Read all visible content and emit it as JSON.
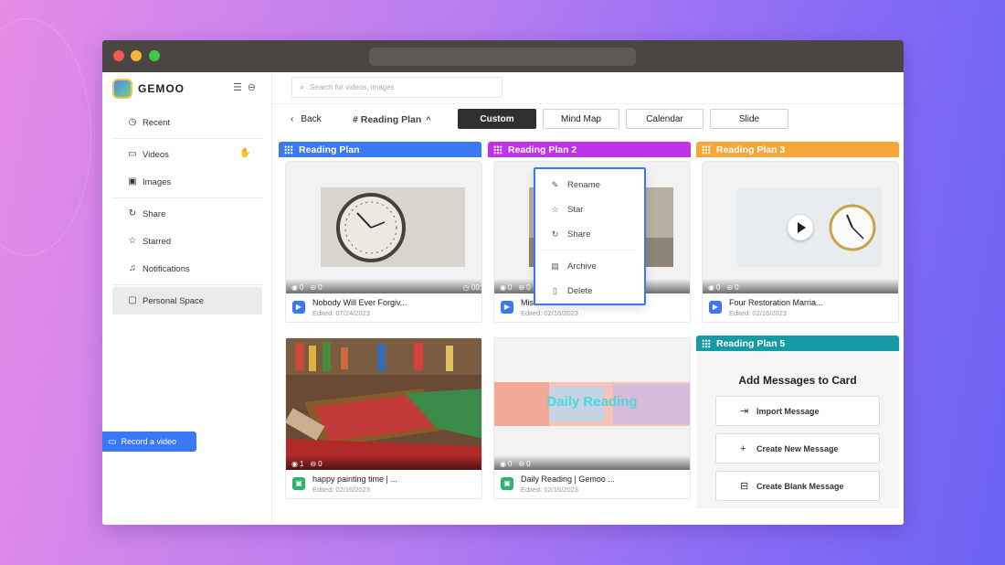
{
  "brand": {
    "name": "GEMOO"
  },
  "sidebar": {
    "items": [
      {
        "label": "Recent",
        "icon": "clock-icon"
      },
      {
        "label": "Videos",
        "icon": "video-icon"
      },
      {
        "label": "Images",
        "icon": "image-icon"
      },
      {
        "label": "Share",
        "icon": "share-icon"
      },
      {
        "label": "Starred",
        "icon": "star-icon"
      },
      {
        "label": "Notifications",
        "icon": "bell-icon"
      }
    ],
    "space": {
      "label": "Personal Space",
      "icon": "folder-icon"
    },
    "record_label": "Record a video"
  },
  "search": {
    "placeholder": "Search for videos, images"
  },
  "toolbar": {
    "back_label": "Back",
    "plan_title": "# Reading Plan",
    "views": [
      "Custom",
      "Mind Map",
      "Calendar",
      "Slide"
    ],
    "active_view": "Custom"
  },
  "menu": {
    "items": [
      "Rename",
      "Star",
      "Share",
      "Archive",
      "Delete"
    ]
  },
  "columns": [
    {
      "title": "Reading Plan",
      "color": "#3a78f5"
    },
    {
      "title": "Reading Plan 2",
      "color": "#c032e8"
    },
    {
      "title": "Reading Plan 3",
      "color": "#f7a63a"
    },
    {
      "title": "Reading Plan 5",
      "color": "#159aa6"
    }
  ],
  "cards": [
    {
      "title": "Nobody Will Ever Forgiv...",
      "date": "Edited: 07/24/2023",
      "views": "0",
      "comments": "0",
      "duration": "00:",
      "type": "video"
    },
    {
      "title": "happy painting time | ...",
      "date": "Edited: 02/16/2023",
      "views": "1",
      "comments": "0",
      "type": "image"
    },
    {
      "title": "Misalliance",
      "date": "Edited: 02/16/2023",
      "views": "0",
      "comments": "0",
      "type": "video"
    },
    {
      "title": "Daily Reading | Gemoo ...",
      "date": "Edited: 02/16/2023",
      "views": "0",
      "comments": "0",
      "type": "image",
      "overlay_text": "Daily Reading"
    },
    {
      "title": "Four Restoration Marria...",
      "date": "Edited: 02/16/2023",
      "views": "0",
      "comments": "0",
      "type": "video"
    }
  ],
  "add_panel": {
    "title": "Add Messages to Card",
    "buttons": [
      "Import Message",
      "Create New Message",
      "Create Blank Message"
    ]
  }
}
